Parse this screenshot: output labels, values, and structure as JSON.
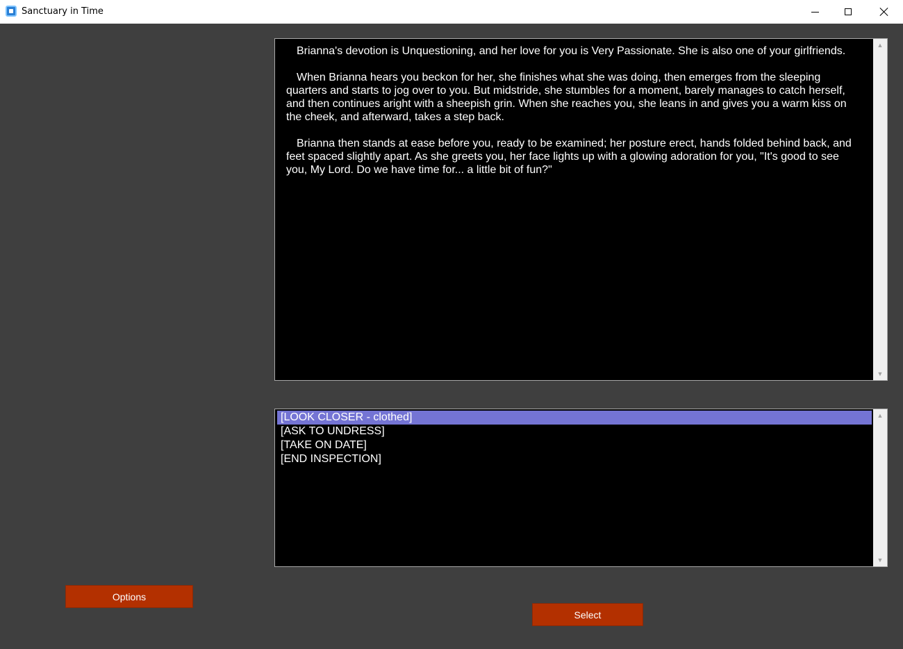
{
  "window": {
    "title": "Sanctuary in Time",
    "icon": "app-icon",
    "controls": [
      "minimize-icon",
      "maximize-icon",
      "close-icon"
    ]
  },
  "narration": {
    "paragraphs": [
      "Brianna's devotion is Unquestioning, and her love for you is Very Passionate. She is also one of your girlfriends.",
      "When Brianna hears you beckon for her, she finishes what she was doing, then emerges from the sleeping quarters and starts to jog over to you. But midstride, she stumbles for a moment, barely manages to catch herself, and then continues aright with a sheepish grin. When she reaches you, she leans in and gives you a warm kiss on the cheek, and afterward, takes a step back.",
      "Brianna then stands at ease before you, ready to be examined; her posture erect, hands folded behind back, and feet spaced slightly apart. As she greets you, her face lights up with a glowing adoration for you, \"It's good to see you, My Lord. Do we have time for... a little bit of fun?\""
    ]
  },
  "choices": {
    "selected_index": 0,
    "items": [
      "[LOOK CLOSER - clothed]",
      "[ASK TO UNDRESS]",
      "[TAKE ON DATE]",
      "[END INSPECTION]"
    ]
  },
  "buttons": {
    "options_label": "Options",
    "select_label": "Select"
  },
  "colors": {
    "background": "#3f3f3f",
    "panel": "#000000",
    "selection": "#7474d4",
    "button": "#b33000"
  }
}
